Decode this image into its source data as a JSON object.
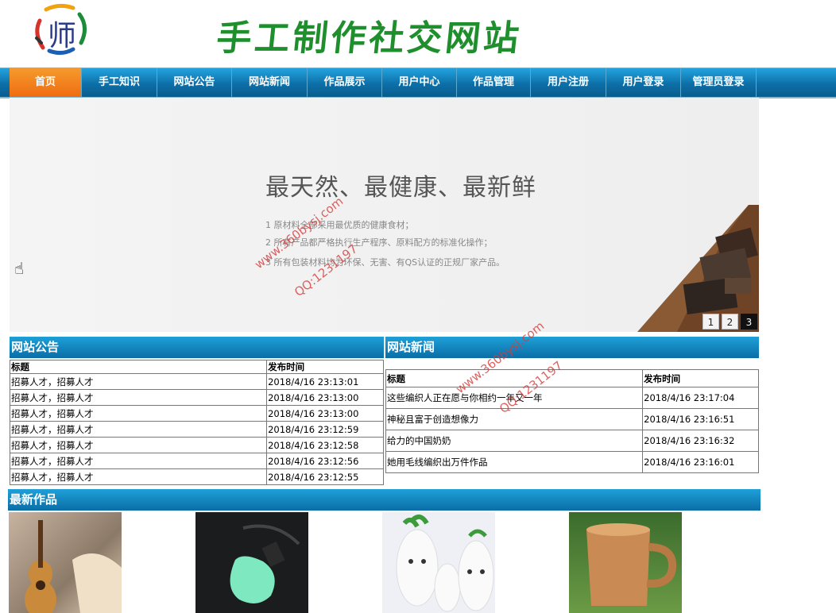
{
  "header": {
    "logo_char": "师",
    "site_title": "手工制作社交网站"
  },
  "nav": [
    {
      "label": "首页",
      "active": true
    },
    {
      "label": "手工知识"
    },
    {
      "label": "网站公告"
    },
    {
      "label": "网站新闻"
    },
    {
      "label": "作品展示"
    },
    {
      "label": "用户中心"
    },
    {
      "label": "作品管理"
    },
    {
      "label": "用户注册"
    },
    {
      "label": "用户登录"
    },
    {
      "label": "管理员登录"
    }
  ],
  "banner": {
    "headline": "最天然、最健康、最新鲜",
    "lines": [
      "1 原材料全部采用最优质的健康食材；",
      "2 所有产品都严格执行生产程序、原料配方的标准化操作；",
      "3 所有包装材料均为环保、无害、有QS认证的正规厂家产品。"
    ],
    "pages": [
      "1",
      "2",
      "3"
    ],
    "active_page": 3
  },
  "watermark": {
    "site": "www.360bysj.com",
    "qq": "QQ:1231197"
  },
  "announcements": {
    "title": "网站公告",
    "columns": [
      "标题",
      "发布时间"
    ],
    "rows": [
      [
        "招募人才，招募人才",
        "2018/4/16 23:13:01"
      ],
      [
        "招募人才，招募人才",
        "2018/4/16 23:13:00"
      ],
      [
        "招募人才，招募人才",
        "2018/4/16 23:13:00"
      ],
      [
        "招募人才，招募人才",
        "2018/4/16 23:12:59"
      ],
      [
        "招募人才，招募人才",
        "2018/4/16 23:12:58"
      ],
      [
        "招募人才，招募人才",
        "2018/4/16 23:12:56"
      ],
      [
        "招募人才，招募人才",
        "2018/4/16 23:12:55"
      ]
    ]
  },
  "news": {
    "title": "网站新闻",
    "columns": [
      "标题",
      "发布时间"
    ],
    "rows": [
      [
        "这些编织人正在愿与你相约一年又一年",
        "2018/4/16 23:17:04"
      ],
      [
        "神秘且富于创造想像力",
        "2018/4/16 23:16:51"
      ],
      [
        "给力的中国奶奶",
        "2018/4/16 23:16:32"
      ],
      [
        "她用毛线编织出万件作品",
        "2018/4/16 23:16:01"
      ]
    ]
  },
  "works": {
    "title": "最新作品",
    "items": [
      {
        "name": "guitar-craft-photo"
      },
      {
        "name": "green-lamp-photo"
      },
      {
        "name": "radish-dolls-photo"
      },
      {
        "name": "wooden-cup-photo"
      }
    ]
  }
}
